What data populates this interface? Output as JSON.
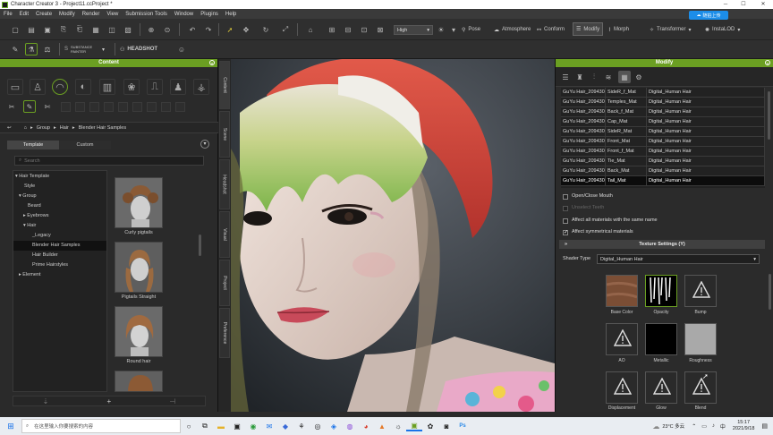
{
  "window": {
    "title": "Character Creator 3 - Project11.ccProject *"
  },
  "cloud_button": "随拍上传",
  "menu": [
    "File",
    "Edit",
    "Create",
    "Modify",
    "Render",
    "View",
    "Submission Tools",
    "Window",
    "Plugins",
    "Help"
  ],
  "toolbar": {
    "quality": "High",
    "pose": "Pose",
    "atmosphere": "Atmosphere",
    "conform": "Conform",
    "modify": "Modify",
    "morph": "Morph",
    "transformer": "Transformer",
    "instalod": "InstaLOD",
    "substance": "SUBSTANCE PAINTER",
    "headshot": "HEADSHOT"
  },
  "content_panel": {
    "title": "Content",
    "breadcrumb": [
      "Group",
      "Hair",
      "Blender Hair Samples"
    ],
    "tabs": [
      "Template",
      "Custom"
    ],
    "search_placeholder": "Search",
    "tree": [
      {
        "label": "Hair Template",
        "arrow": "▾"
      },
      {
        "label": "Style",
        "arrow": ""
      },
      {
        "label": "Group",
        "arrow": "▾"
      },
      {
        "label": "Beard",
        "arrow": ""
      },
      {
        "label": "Eyebrows",
        "arrow": "▸"
      },
      {
        "label": "Hair",
        "arrow": "▾"
      },
      {
        "label": "_Legacy",
        "arrow": ""
      },
      {
        "label": "Blender Hair Samples",
        "arrow": ""
      },
      {
        "label": "Hair Builder",
        "arrow": ""
      },
      {
        "label": "Prime Hairstyles",
        "arrow": ""
      },
      {
        "label": "Element",
        "arrow": "▸"
      }
    ],
    "thumbnails": [
      "Curly pigtails",
      "Pigtails Straight",
      "Round hair",
      ""
    ],
    "footer": {
      "add": "+",
      "mid": "⇣"
    }
  },
  "side_tabs": [
    "Content",
    "Scene",
    "Headshot",
    "Visual",
    "Project",
    "Preference"
  ],
  "modify_panel": {
    "title": "Modify",
    "materials": [
      {
        "name": "GuYu Hair_209430",
        "mat": "SideR_f_Mat",
        "shader": "Digital_Human Hair"
      },
      {
        "name": "GuYu Hair_209430",
        "mat": "Temples_Mat",
        "shader": "Digital_Human Hair"
      },
      {
        "name": "GuYu Hair_209430",
        "mat": "Back_f_Mat",
        "shader": "Digital_Human Hair"
      },
      {
        "name": "GuYu Hair_209430",
        "mat": "Cap_Mat",
        "shader": "Digital_Human Hair"
      },
      {
        "name": "GuYu Hair_209430",
        "mat": "SideR_Mat",
        "shader": "Digital_Human Hair"
      },
      {
        "name": "GuYu Hair_209430",
        "mat": "Front_Mat",
        "shader": "Digital_Human Hair"
      },
      {
        "name": "GuYu Hair_209430",
        "mat": "Front_f_Mat",
        "shader": "Digital_Human Hair"
      },
      {
        "name": "GuYu Hair_209430",
        "mat": "Tie_Mat",
        "shader": "Digital_Human Hair"
      },
      {
        "name": "GuYu Hair_209430",
        "mat": "Back_Mat",
        "shader": "Digital_Human Hair"
      },
      {
        "name": "GuYu Hair_209430",
        "mat": "Tail_Mat",
        "shader": "Digital_Human Hair"
      }
    ],
    "open_close_mouth": "Open/Close Mouth",
    "unselect_teeth": "Unselect Teeth",
    "affect_same_name": "Affect all materials with the same name",
    "affect_symmetrical": "Affect symmetrical materials",
    "texture_settings": "Texture Settings  (Y)",
    "shader_type_label": "Shader Type",
    "shader_type_value": "Digital_Human Hair",
    "textures": [
      "Base Color",
      "Opacity",
      "Bump",
      "AO",
      "Metallic",
      "Roughness",
      "Displacement",
      "Glow",
      "Blend"
    ]
  },
  "taskbar": {
    "search_placeholder": "在这里输入你要搜索的内容",
    "weather": "23°C 多云",
    "time": "15:17",
    "date": "2021/9/18",
    "lang": "中"
  }
}
